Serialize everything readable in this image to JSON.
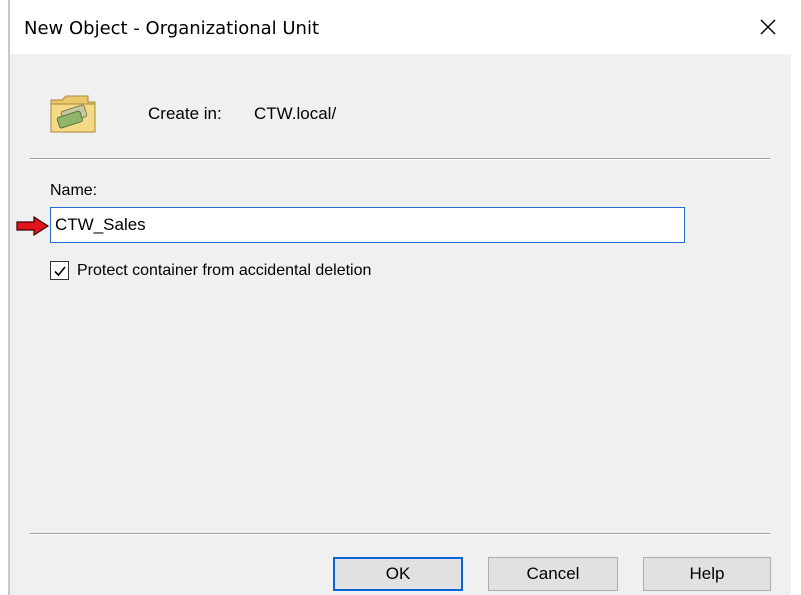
{
  "window": {
    "title": "New Object - Organizational Unit",
    "close_glyph": "✕"
  },
  "header": {
    "icon": "organizational-unit-folder-icon",
    "create_in_label": "Create in:",
    "create_in_path": "CTW.local/"
  },
  "form": {
    "name_label": "Name:",
    "name_value": "CTW_Sales",
    "protect_checkbox": {
      "label": "Protect container from accidental deletion",
      "checked": true
    }
  },
  "buttons": {
    "ok": "OK",
    "cancel": "Cancel",
    "help": "Help"
  },
  "annotation": {
    "arrow_icon": "red-arrow-icon",
    "arrow_color": "#e0141a"
  },
  "colors": {
    "dialog_bg": "#f0f0f0",
    "focus_border": "#1e6fd0",
    "ok_border": "#0a64d6"
  }
}
